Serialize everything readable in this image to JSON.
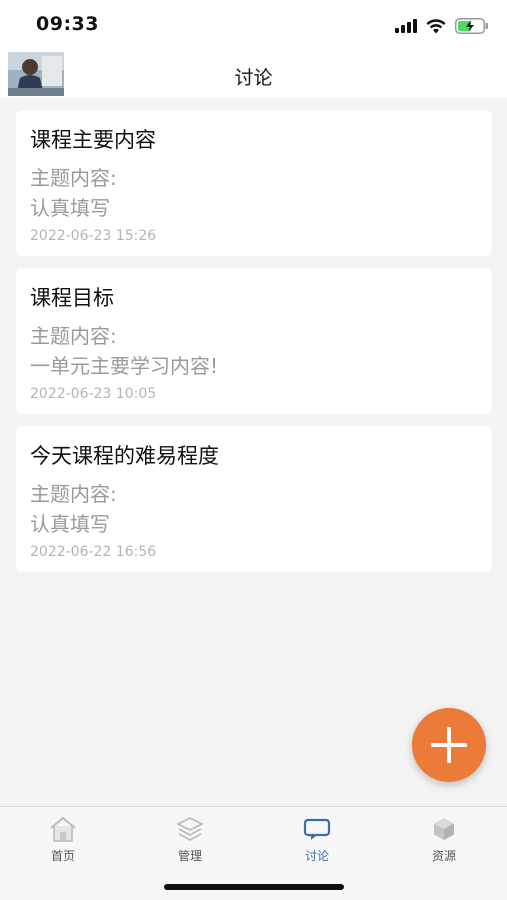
{
  "status_bar": {
    "time": "09:33",
    "icons": [
      "cellular-signal-icon",
      "wifi-icon",
      "battery-charging-icon"
    ]
  },
  "header": {
    "title": "讨论",
    "avatar_icon": "user-avatar-photo"
  },
  "topics": [
    {
      "title": "课程主要内容",
      "label": "主题内容:",
      "content": "认真填写",
      "date": "2022-06-23 15:26"
    },
    {
      "title": "课程目标",
      "label": "主题内容:",
      "content": "一单元主要学习内容!",
      "date": "2022-06-23 10:05"
    },
    {
      "title": "今天课程的难易程度",
      "label": "主题内容:",
      "content": "认真填写",
      "date": "2022-06-22 16:56"
    }
  ],
  "fab": {
    "icon": "plus-icon",
    "color": "#ec7a38"
  },
  "tab_bar": {
    "active_color": "#3a6ea5",
    "tabs": [
      {
        "label": "首页",
        "icon": "home-icon",
        "active": false
      },
      {
        "label": "管理",
        "icon": "layers-icon",
        "active": false
      },
      {
        "label": "讨论",
        "icon": "chat-icon",
        "active": true
      },
      {
        "label": "资源",
        "icon": "resource-cube-icon",
        "active": false
      }
    ]
  }
}
